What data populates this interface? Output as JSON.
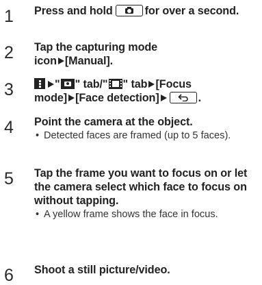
{
  "steps": [
    {
      "number": "1",
      "text_before": "Press and hold",
      "text_after": "for over a second."
    },
    {
      "number": "2",
      "line1": "Tap the capturing mode",
      "line2_text": "icon",
      "line2_item": "[Manual]."
    },
    {
      "number": "3",
      "q1": "\"",
      "tab1": "\" tab/\"",
      "tab2": "\" tab",
      "item1": "[Focus",
      "item2": "mode]",
      "item3": "[Face detection]",
      "end": "."
    },
    {
      "number": "4",
      "title": "Point the camera at the object.",
      "note_bullet": "•",
      "note": "Detected faces are framed (up to 5 faces)."
    },
    {
      "number": "5",
      "title": "Tap the frame you want to focus on or let the camera select which face to focus on without tapping.",
      "note_bullet": "•",
      "note": "A yellow frame shows the face in focus."
    },
    {
      "number": "6",
      "title": "Shoot a still picture/video."
    }
  ],
  "icons": {
    "camera_key": "camera-key-icon",
    "arrow": "right-triangle-arrow-icon",
    "menu": "menu-icon",
    "camera_tab": "camera-tab-icon",
    "video_tab": "video-tab-icon",
    "back": "back-icon"
  }
}
